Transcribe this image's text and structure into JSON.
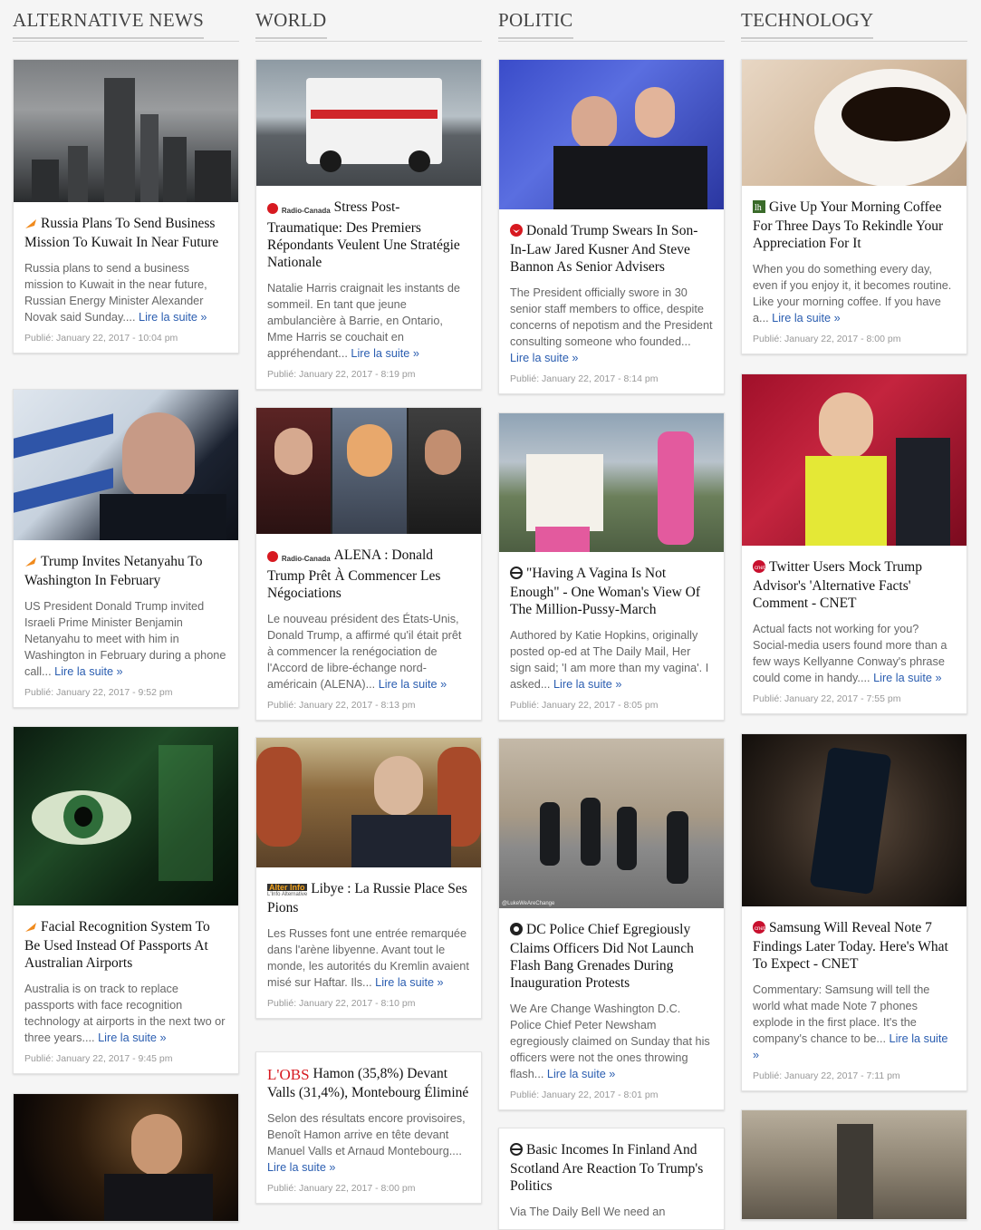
{
  "columns": [
    {
      "heading": "ALTERNATIVE NEWS",
      "cards": [
        {
          "title": "Russia Plans To Send Business Mission To Kuwait In Near Future",
          "source_icon": "orange-arrow-icon",
          "excerpt": "Russia plans to send a business mission to Kuwait in the near future, Russian Energy Minister Alexander Novak said Sunday....",
          "more": "Lire la suite »",
          "date": "Publié: January 22, 2017 - 10:04 pm"
        },
        {
          "title": "Trump Invites Netanyahu To Washington In February",
          "source_icon": "orange-arrow-icon",
          "excerpt": "US President Donald Trump invited Israeli Prime Minister Benjamin Netanyahu to meet with him in Washington in February during a phone call...",
          "more": "Lire la suite »",
          "date": "Publié: January 22, 2017 - 9:52 pm"
        },
        {
          "title": "Facial Recognition System To Be Used Instead Of Passports At Australian Airports",
          "source_icon": "orange-arrow-icon",
          "excerpt": "Australia is on track to replace passports with face recognition technology at airports in the next two or three years....",
          "more": "Lire la suite »",
          "date": "Publié: January 22, 2017 - 9:45 pm"
        },
        {
          "title": "",
          "source_icon": "",
          "excerpt": "",
          "more": "",
          "date": ""
        }
      ]
    },
    {
      "heading": "WORLD",
      "cards": [
        {
          "title": "Stress Post-Traumatique: Des Premiers Répondants Veulent Une Stratégie Nationale",
          "source_icon": "radio-canada-logo",
          "source_text": "Radio-Canada",
          "excerpt": "Natalie Harris craignait les instants de sommeil. En tant que jeune ambulancière à Barrie, en Ontario, Mme Harris se couchait en appréhendant...",
          "more": "Lire la suite »",
          "date": "Publié: January 22, 2017 - 8:19 pm"
        },
        {
          "title": "ALENA : Donald Trump Prêt À Commencer Les Négociations",
          "source_icon": "radio-canada-logo",
          "source_text": "Radio-Canada",
          "excerpt": "Le nouveau président des États-Unis, Donald Trump, a affirmé qu'il était prêt à commencer la renégociation de l'Accord de libre-échange nord-américain (ALENA)...",
          "more": "Lire la suite »",
          "date": "Publié: January 22, 2017 - 8:13 pm"
        },
        {
          "title": "Libye : La Russie Place Ses Pions",
          "source_icon": "alter-info-logo",
          "source_text": "Alter Info",
          "source_sub": "L'Info Alternative",
          "excerpt": "Les Russes font une entrée remarquée dans l'arène libyenne. Avant tout le monde, les autorités du Kremlin avaient misé sur Haftar. Ils...",
          "more": "Lire la suite »",
          "date": "Publié: January 22, 2017 - 8:10 pm"
        },
        {
          "title": "Hamon (35,8%) Devant Valls (31,4%), Montebourg Éliminé",
          "source_icon": "lobs-logo",
          "source_text": "L'OBS",
          "excerpt": "Selon des résultats encore provisoires, Benoît Hamon arrive en tête devant Manuel Valls et Arnaud Montebourg....",
          "more": "Lire la suite »",
          "date": "Publié: January 22, 2017 - 8:00 pm"
        }
      ]
    },
    {
      "heading": "POLITIC",
      "cards": [
        {
          "title": "Donald Trump Swears In Son-In-Law Jared Kusner And Steve Bannon As Senior Advisers",
          "source_icon": "red-eagle-icon",
          "excerpt": "The President officially swore in 30 senior staff members to office, despite concerns of nepotism and the President consulting someone who founded...",
          "more": "Lire la suite »",
          "date": "Publié: January 22, 2017 - 8:14 pm"
        },
        {
          "title": "\"Having A Vagina Is Not Enough\" - One Woman's View Of The Million-Pussy-March",
          "source_icon": "theta-icon",
          "excerpt": "Authored by Katie Hopkins, originally posted op-ed at The Daily Mail, Her sign said; 'I am more than my vagina'. I asked...",
          "more": "Lire la suite »",
          "date": "Publié: January 22, 2017 - 8:05 pm"
        },
        {
          "title": "DC Police Chief Egregiously Claims Officers Did Not Launch Flash Bang Grenades During Inauguration Protests",
          "source_icon": "we-are-change-icon",
          "excerpt": "We Are Change Washington D.C. Police Chief Peter Newsham egregiously claimed on Sunday that his officers were not the ones throwing flash...",
          "more": "Lire la suite »",
          "date": "Publié: January 22, 2017 - 8:01 pm",
          "img_caption": "@LukeWeAreChange"
        },
        {
          "title": "Basic Incomes In Finland And Scotland Are Reaction To Trump's Politics",
          "source_icon": "theta-icon",
          "excerpt": "Via The Daily Bell   We need an",
          "more": "",
          "date": ""
        }
      ]
    },
    {
      "heading": "TECHNOLOGY",
      "cards": [
        {
          "title": "Give Up Your Morning Coffee For Three Days To Rekindle Your Appreciation For It",
          "source_icon": "lifehacker-icon",
          "excerpt": "When you do something every day, even if you enjoy it, it becomes routine. Like your morning coffee. If you have a...",
          "more": "Lire la suite »",
          "date": "Publié: January 22, 2017 - 8:00 pm"
        },
        {
          "title": "Twitter Users Mock Trump Advisor's 'Alternative Facts' Comment - CNET",
          "source_icon": "cnet-icon",
          "excerpt": "Actual facts not working for you? Social-media users found more than a few ways Kellyanne Conway's phrase could come in handy....",
          "more": "Lire la suite »",
          "date": "Publié: January 22, 2017 - 7:55 pm"
        },
        {
          "title": "Samsung Will Reveal Note 7 Findings Later Today. Here's What To Expect - CNET",
          "source_icon": "cnet-icon",
          "excerpt": "Commentary: Samsung will tell the world what made Note 7 phones explode in the first place. It's the company's chance to be...",
          "more": "Lire la suite »",
          "date": "Publié: January 22, 2017 - 7:11 pm"
        },
        {
          "title": "",
          "source_icon": "",
          "excerpt": "",
          "more": "",
          "date": ""
        }
      ]
    }
  ]
}
